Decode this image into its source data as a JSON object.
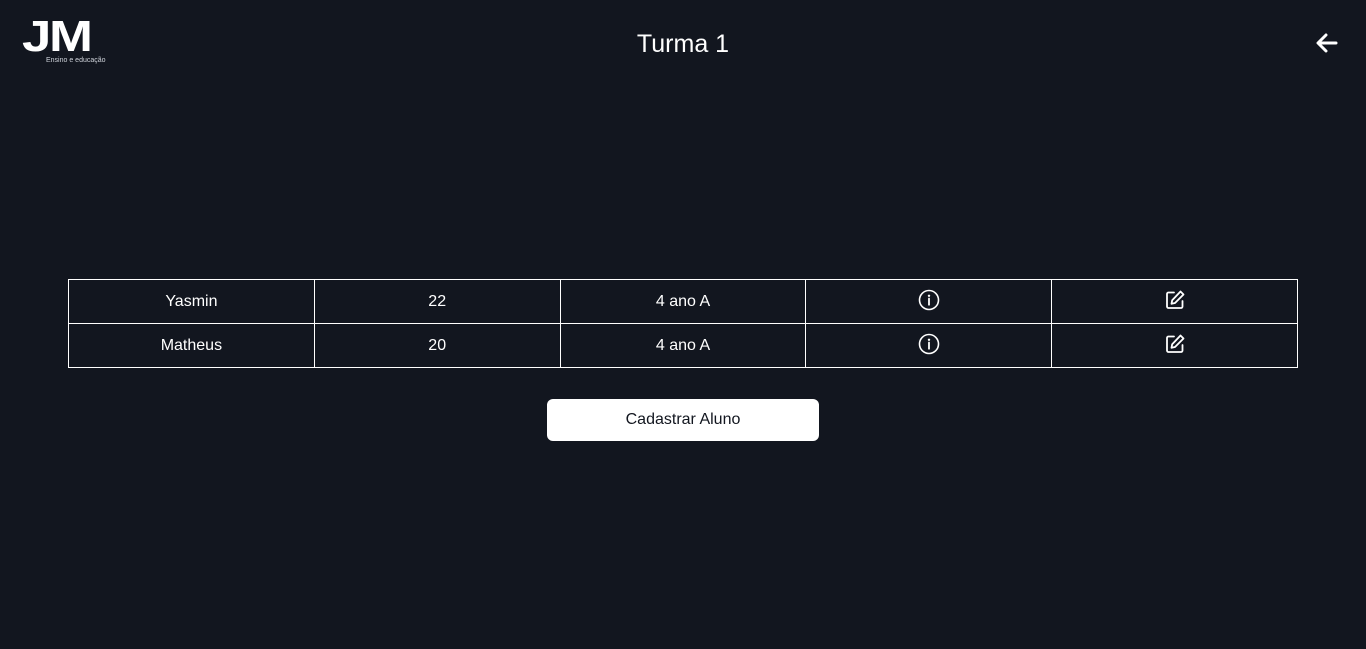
{
  "header": {
    "logo_text": "JM",
    "logo_subtitle": "Ensino e educação",
    "title": "Turma 1",
    "back_icon": "arrow-left-icon"
  },
  "students": [
    {
      "name": "Yasmin",
      "age": "22",
      "class": "4 ano A",
      "info_icon": "info-circle-icon",
      "edit_icon": "edit-icon"
    },
    {
      "name": "Matheus",
      "age": "20",
      "class": "4 ano A",
      "info_icon": "info-circle-icon",
      "edit_icon": "edit-icon"
    }
  ],
  "actions": {
    "register_label": "Cadastrar Aluno"
  },
  "colors": {
    "background": "#12161f",
    "foreground": "#ffffff"
  }
}
